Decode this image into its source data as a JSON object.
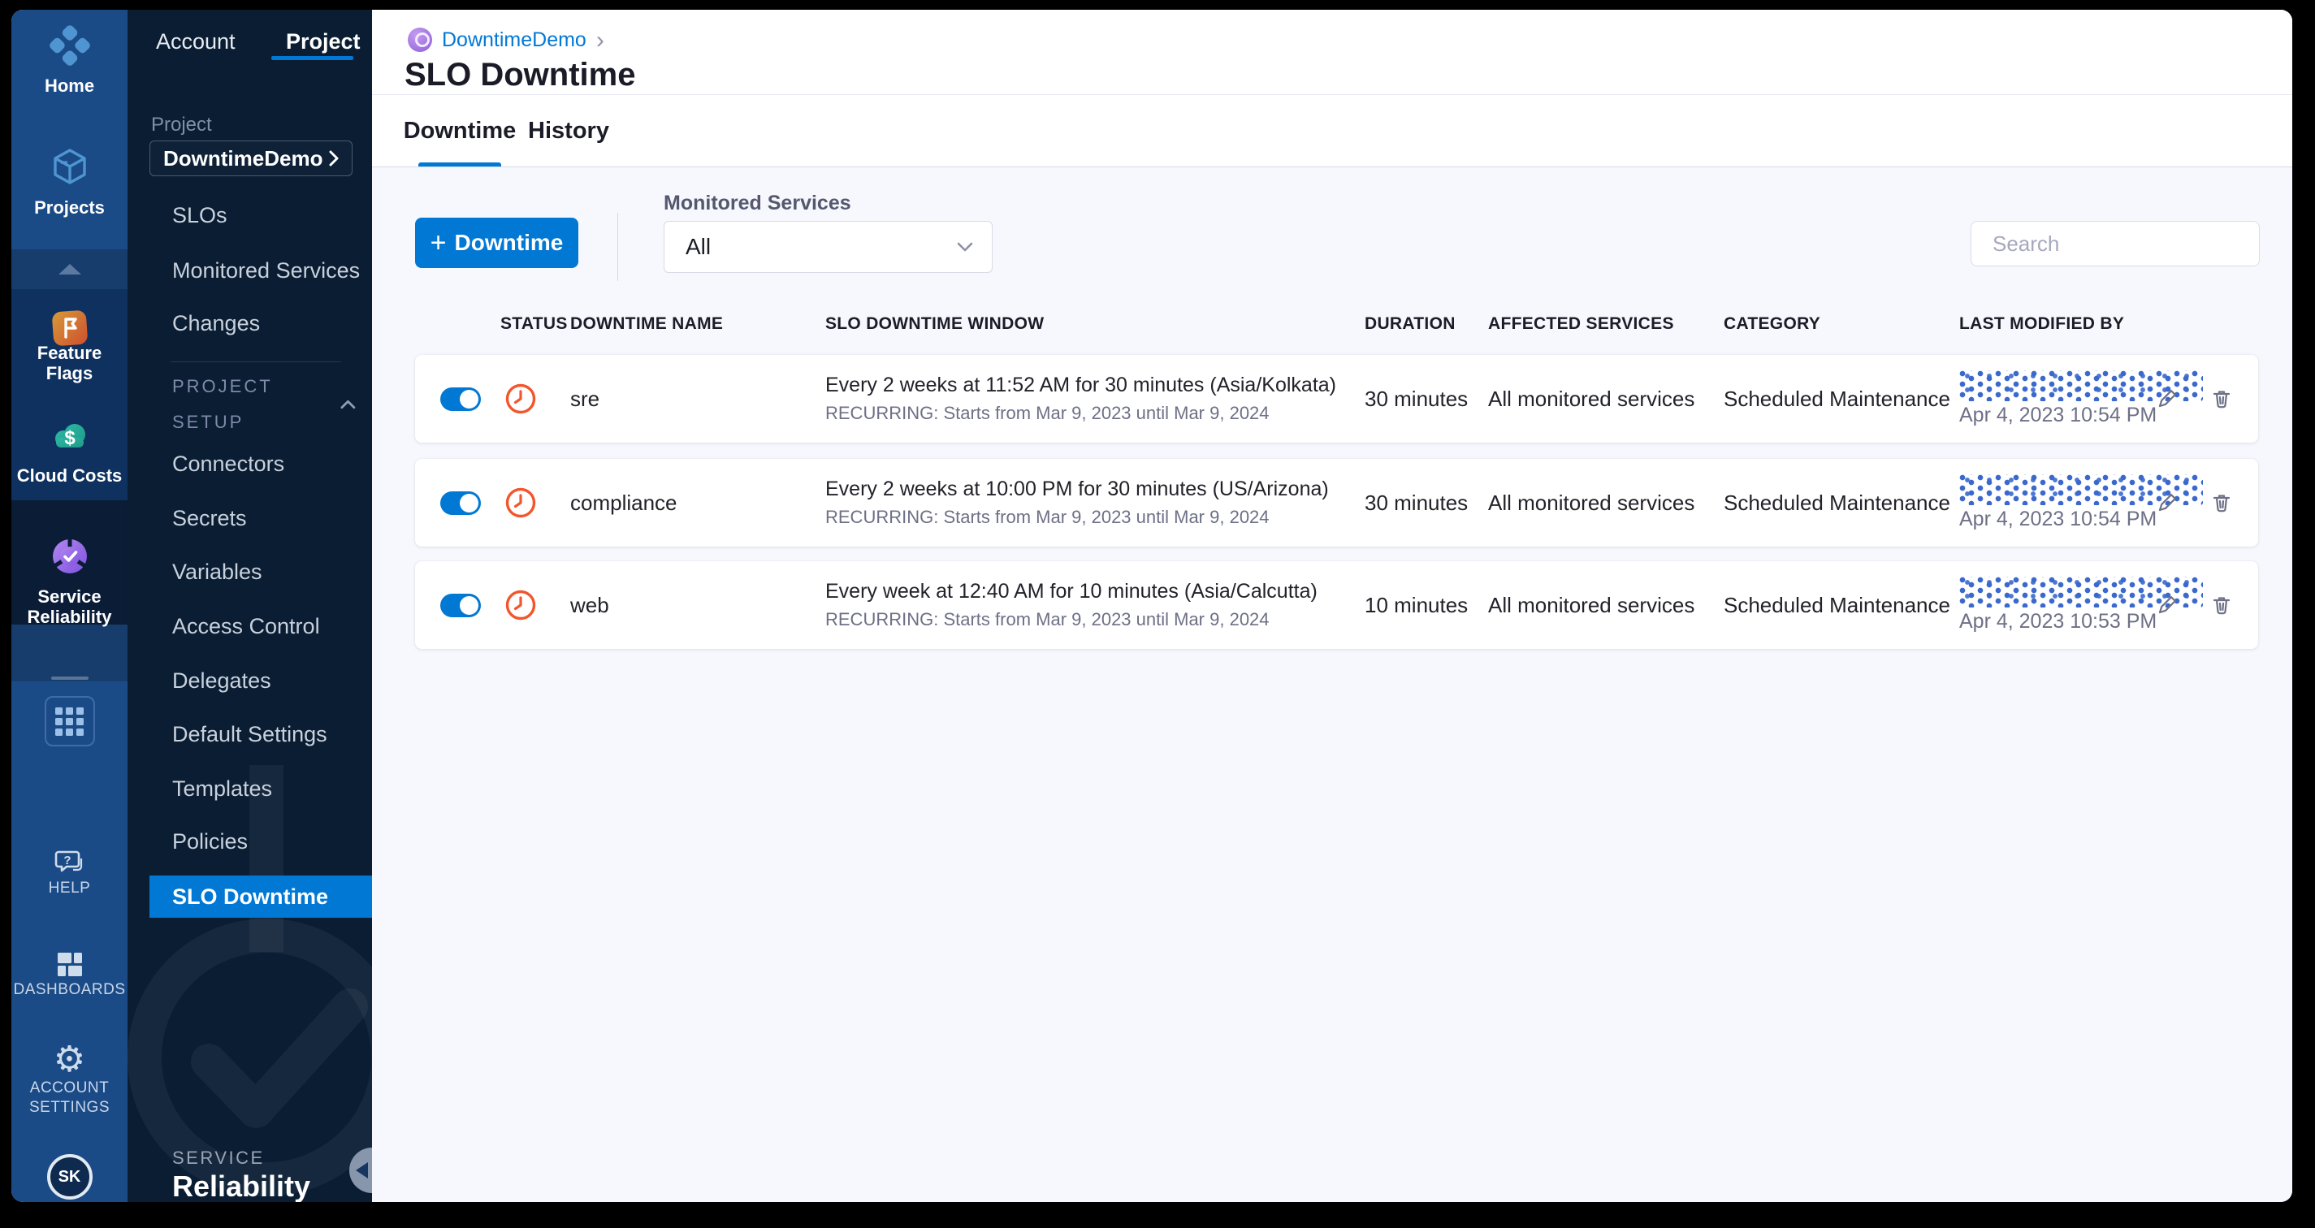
{
  "rail": {
    "top": [
      {
        "label": "Home"
      },
      {
        "label": "Projects"
      }
    ],
    "modules": [
      {
        "label": "Feature Flags"
      },
      {
        "label": "Cloud Costs"
      },
      {
        "label": "Service Reliability"
      }
    ],
    "bottom": [
      {
        "label": "HELP"
      },
      {
        "label": "DASHBOARDS"
      },
      {
        "label": "ACCOUNT SETTINGS"
      }
    ],
    "avatar": "SK"
  },
  "sidebar": {
    "tabs": [
      {
        "label": "Account"
      },
      {
        "label": "Project"
      }
    ],
    "project_label": "Project",
    "project_name": "DowntimeDemo",
    "items": [
      {
        "label": "SLOs"
      },
      {
        "label": "Monitored Services"
      },
      {
        "label": "Changes"
      }
    ],
    "setup_header": "PROJECT SETUP",
    "setup_items": [
      {
        "label": "Connectors"
      },
      {
        "label": "Secrets"
      },
      {
        "label": "Variables"
      },
      {
        "label": "Access Control"
      },
      {
        "label": "Delegates"
      },
      {
        "label": "Default Settings"
      },
      {
        "label": "Templates"
      },
      {
        "label": "Policies"
      },
      {
        "label": "SLO Downtime"
      }
    ],
    "footer": {
      "eyebrow": "SERVICE",
      "name": "Reliability"
    }
  },
  "header": {
    "breadcrumb": "DowntimeDemo",
    "breadcrumb_chevron": "›",
    "title": "SLO Downtime",
    "tabs": [
      {
        "label": "Downtime"
      },
      {
        "label": "History"
      }
    ]
  },
  "toolbar": {
    "plus": "+",
    "new_downtime": "Downtime",
    "filter_label": "Monitored Services",
    "filter_value": "All",
    "search_placeholder": "Search"
  },
  "table": {
    "columns": [
      "STATUS",
      "DOWNTIME NAME",
      "SLO DOWNTIME WINDOW",
      "DURATION",
      "AFFECTED SERVICES",
      "CATEGORY",
      "LAST MODIFIED BY"
    ],
    "rows": [
      {
        "status": "on",
        "name": "sre",
        "window": "Every 2 weeks at 11:52 AM for 30 minutes (Asia/Kolkata)",
        "recurrence": "RECURRING: Starts from Mar 9, 2023 until Mar 9, 2024",
        "duration": "30 minutes",
        "affected_services": "All monitored services",
        "category": "Scheduled Maintenance",
        "last_modified": "Apr 4, 2023 10:54 PM"
      },
      {
        "status": "on",
        "name": "compliance",
        "window": "Every 2 weeks at 10:00 PM for 30 minutes (US/Arizona)",
        "recurrence": "RECURRING: Starts from Mar 9, 2023 until Mar 9, 2024",
        "duration": "30 minutes",
        "affected_services": "All monitored services",
        "category": "Scheduled Maintenance",
        "last_modified": "Apr 4, 2023 10:54 PM"
      },
      {
        "status": "on",
        "name": "web",
        "window": "Every week at 12:40 AM for 10 minutes (Asia/Calcutta)",
        "recurrence": "RECURRING: Starts from Mar 9, 2023 until Mar 9, 2024",
        "duration": "10 minutes",
        "affected_services": "All monitored services",
        "category": "Scheduled Maintenance",
        "last_modified": "Apr 4, 2023 10:53 PM"
      }
    ]
  },
  "colors": {
    "accent": "#0278d5",
    "toggle_on": "#0278d5",
    "clock_icon": "#f2562c",
    "redaction_dots": "#3b68cc",
    "rail_bg": "#1b4b87",
    "sidebar_bg": "#0a1d33",
    "content_bg": "#f6f8fd",
    "selected_nav_bg": "#0278d5"
  }
}
